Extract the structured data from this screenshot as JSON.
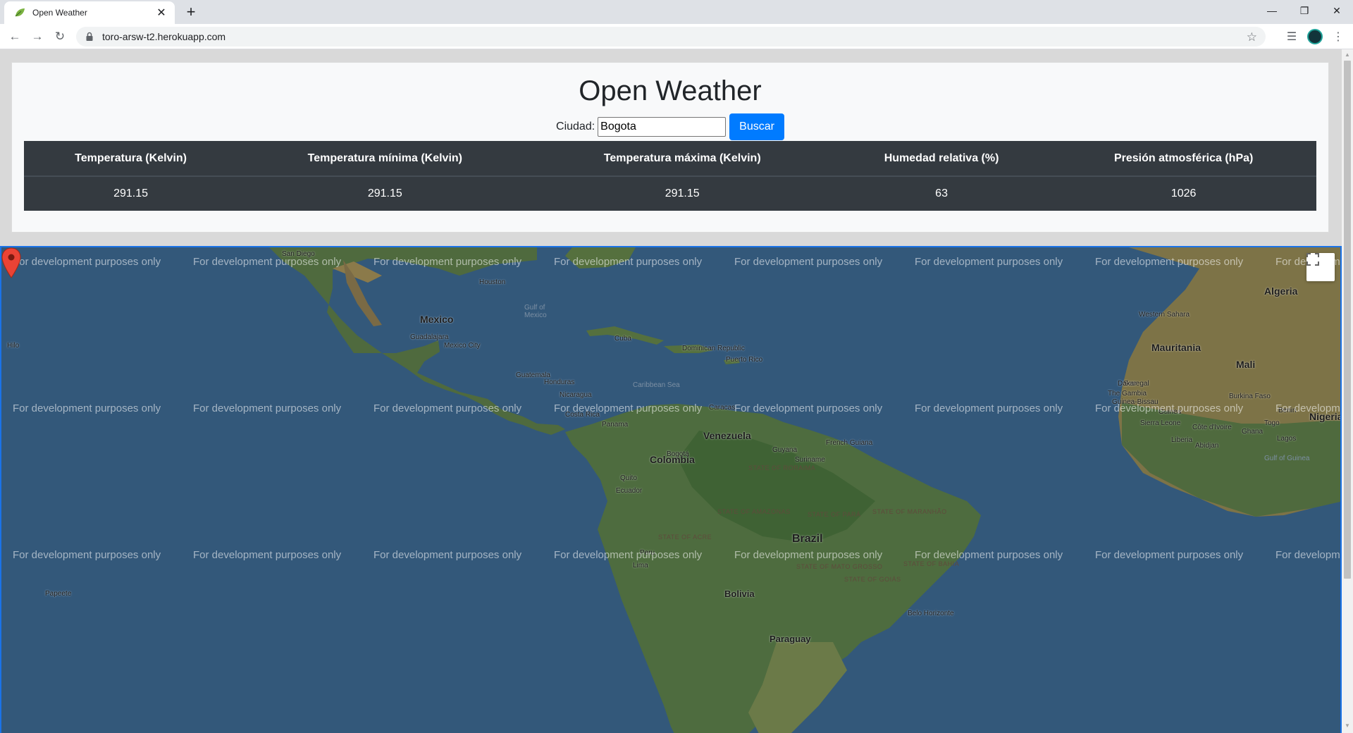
{
  "browser": {
    "tab_title": "Open Weather",
    "url": "toro-arsw-t2.herokuapp.com",
    "icons": {
      "favicon": "leaf-icon",
      "close": "close-icon",
      "new_tab": "plus-icon",
      "back": "back-arrow-icon",
      "forward": "forward-arrow-icon",
      "reload": "reload-icon",
      "lock": "lock-icon",
      "bookmark": "star-icon",
      "media": "media-queue-icon",
      "menu": "kebab-menu-icon"
    }
  },
  "page": {
    "title": "Open Weather",
    "city_label": "Ciudad:",
    "city_value": "Bogota",
    "search_button": "Buscar",
    "accent_color": "#007bff",
    "table": {
      "headers": [
        "Temperatura (Kelvin)",
        "Temperatura mínima (Kelvin)",
        "Temperatura máxima (Kelvin)",
        "Humedad relativa (%)",
        "Presión atmosférica (hPa)"
      ],
      "row": [
        "291.15",
        "291.15",
        "291.15",
        "63",
        "1026"
      ]
    }
  },
  "map": {
    "watermark_text": "For development purposes only",
    "marker_city": "Bogotá",
    "labels": {
      "countries": [
        "Mexico",
        "Cuba",
        "Venezuela",
        "Colombia",
        "Brazil",
        "Peru",
        "Bolivia",
        "Paraguay",
        "Algeria",
        "Mauritania",
        "Mali",
        "Nigeria",
        "Guatemala",
        "Honduras",
        "Nicaragua",
        "Costa Rica",
        "Panama",
        "Ecuador",
        "Guyana",
        "Suriname",
        "Western Sahara",
        "Dominican Republic",
        "Senegal",
        "The Gambia",
        "Guinea-Bissau",
        "Guinea",
        "Sierra Leone",
        "Liberia",
        "Burkina Faso",
        "Ghana",
        "Togo",
        "Benin",
        "Côte d'Ivoire",
        "French Guiana",
        "Nige"
      ],
      "cities": [
        "Houston",
        "Guadalajara",
        "Mexico City",
        "San Diego",
        "Puerto Rico",
        "Caracas",
        "Quito",
        "Lima",
        "Dakar",
        "Abidjan",
        "Lagos",
        "Belo Horizonte",
        "Papeete",
        "Hilo"
      ],
      "seas": [
        "Gulf of Mexico",
        "Caribbean Sea",
        "Gulf of Guinea"
      ]
    }
  }
}
